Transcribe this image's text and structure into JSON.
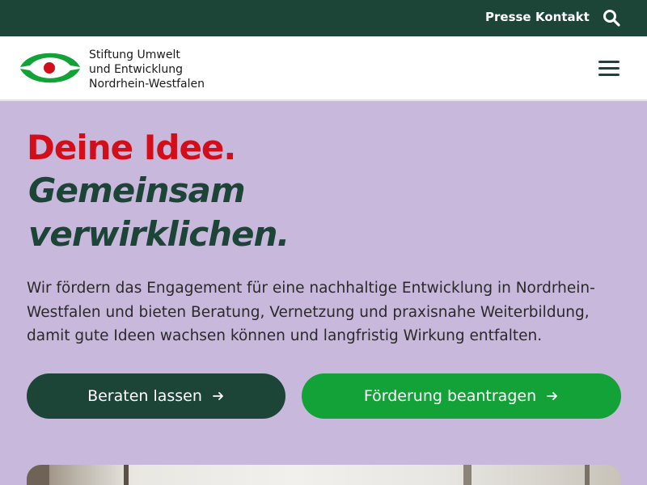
{
  "topbar": {
    "links": [
      "Presse",
      "Kontakt"
    ],
    "search_icon": "search-icon"
  },
  "header": {
    "org_name_lines": [
      "Stiftung Umwelt",
      "und Entwicklung",
      "Nordrhein-Westfalen"
    ],
    "menu_icon": "hamburger-menu-icon"
  },
  "hero": {
    "headline_red": "Deine Idee.",
    "headline_green_1": "Gemeinsam",
    "headline_green_2": "verwirklichen.",
    "intro": "Wir fördern das Engagement für eine nachhaltige Entwicklung in Nordrhein-Westfalen und bieten Beratung, Vernetzung und praxisnahe Weiterbildung, damit gute Ideen wachsen können und langfristig Wirkung entfalten.",
    "buttons": [
      "Beraten lassen",
      "Förderung beantragen"
    ]
  },
  "colors": {
    "dark_green": "#1c4538",
    "bright_green": "#13a238",
    "red": "#d10e19",
    "lavender": "#c8b8dc"
  }
}
